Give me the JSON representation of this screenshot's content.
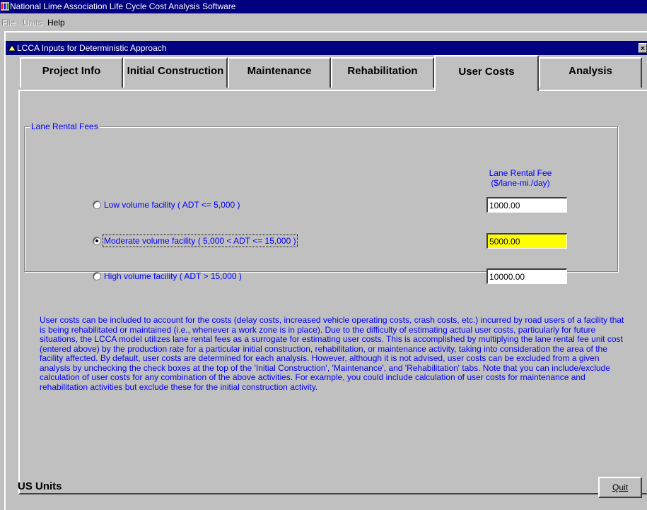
{
  "app": {
    "title": "National Lime Association Life Cycle Cost Analysis Software"
  },
  "menu": [
    {
      "label": "File",
      "enabled": false
    },
    {
      "label": "Units",
      "enabled": false
    },
    {
      "label": "Help",
      "enabled": true
    }
  ],
  "window": {
    "title": "LCCA Inputs for Deterministic Approach"
  },
  "tabs": [
    {
      "label": "Project Info",
      "active": false
    },
    {
      "label": "Initial Construction",
      "active": false
    },
    {
      "label": "Maintenance",
      "active": false
    },
    {
      "label": "Rehabilitation",
      "active": false
    },
    {
      "label": "User Costs",
      "active": true
    },
    {
      "label": "Analysis",
      "active": false
    }
  ],
  "lane_rental": {
    "group_label": "Lane Rental Fees",
    "column_header_line1": "Lane Rental Fee",
    "column_header_line2": "($/lane-mi./day)",
    "options": [
      {
        "label": "Low volume facility ( ADT <= 5,000 )",
        "value": "1000.00",
        "selected": false
      },
      {
        "label": "Moderate volume facility ( 5,000 < ADT <= 15,000 )",
        "value": "5000.00",
        "selected": true
      },
      {
        "label": "High volume facility ( ADT > 15,000 )",
        "value": "10000.00",
        "selected": false
      }
    ],
    "highlight_color": "#ffff00"
  },
  "description": "User costs can be included to account for the costs (delay costs, increased vehicle operating costs, crash costs, etc.) incurred by road users of a facility that is being rehabilitated or maintained (i.e., whenever a work zone is in place).  Due to the difficulty of estimating actual user costs, particularly for future situations, the LCCA model utilizes lane rental fees as a surrogate for estimating user costs.  This is accomplished by multiplying the lane rental fee unit cost (entered above) by the production rate for a particular initial construction, rehabilitation, or maintenance activity, taking into consideration the area of the facility affected.  By default, user costs are determined for each analysis.  However, although it is not advised, user costs can be excluded from a given analysis by unchecking the check boxes at the top of the 'Initial Construction', 'Maintenance', and 'Rehabilitation' tabs.  Note that you can include/exclude calculation of user costs for any combination of the above activities.  For example, you could include calculation of user costs for maintenance and rehabilitation activities but exclude these for the initial construction activity.",
  "footer": {
    "units": "US Units",
    "quit_label": "Quit"
  },
  "colors": {
    "titlebar": "#000080",
    "label_text": "#0000ff",
    "face": "#c0c0c0"
  }
}
